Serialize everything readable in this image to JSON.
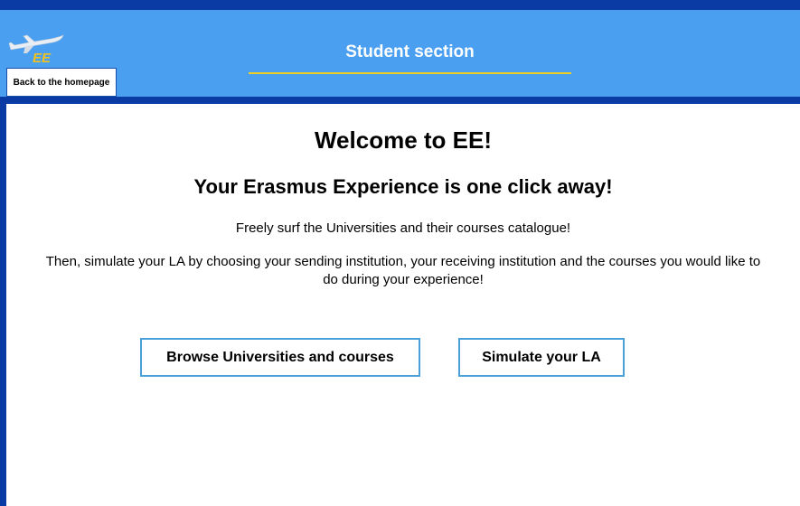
{
  "header": {
    "title": "Student section",
    "logo_text": "EE",
    "back_label": "Back to the homepage"
  },
  "main": {
    "welcome": "Welcome to EE!",
    "subtitle": "Your Erasmus Experience is one click away!",
    "line1": "Freely surf the Universities and their courses catalogue!",
    "line2": "Then, simulate your LA by choosing your sending institution, your receiving institution and the courses you would like to do during your experience!",
    "browse_label": "Browse Universities and courses",
    "simulate_label": "Simulate your LA"
  },
  "colors": {
    "frame": "#0a3aa4",
    "header_bg": "#4a9ff0",
    "underline": "#f0d020",
    "button_border": "#4aa0d8"
  },
  "icons": {
    "logo": "airplane-logo-icon"
  }
}
